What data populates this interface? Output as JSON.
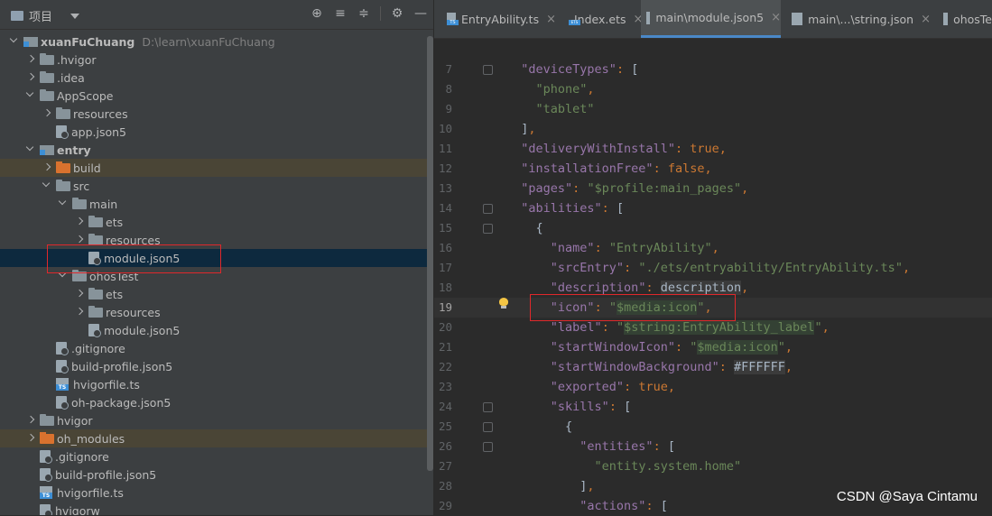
{
  "project_panel": {
    "title": "项目",
    "tools": [
      "crosshair-icon",
      "expand-all-icon",
      "collapse-all-icon",
      "gear-icon",
      "minimize-icon"
    ]
  },
  "tree": [
    {
      "label": "xuanFuChuang",
      "path": "D:\\learn\\xuanFuChuang",
      "depth": 0,
      "arrow": "down",
      "icon": "folder-blue",
      "bold": true
    },
    {
      "label": ".hvigor",
      "depth": 1,
      "arrow": "right",
      "icon": "folder"
    },
    {
      "label": ".idea",
      "depth": 1,
      "arrow": "right",
      "icon": "folder"
    },
    {
      "label": "AppScope",
      "depth": 1,
      "arrow": "down",
      "icon": "folder"
    },
    {
      "label": "resources",
      "depth": 2,
      "arrow": "right",
      "icon": "folder"
    },
    {
      "label": "app.json5",
      "depth": 2,
      "arrow": "none",
      "icon": "file"
    },
    {
      "label": "entry",
      "depth": 1,
      "arrow": "down",
      "icon": "folder-blue",
      "bold": true
    },
    {
      "label": "build",
      "depth": 2,
      "arrow": "right",
      "icon": "folder-orange",
      "highlight": true
    },
    {
      "label": "src",
      "depth": 2,
      "arrow": "down",
      "icon": "folder"
    },
    {
      "label": "main",
      "depth": 3,
      "arrow": "down",
      "icon": "folder"
    },
    {
      "label": "ets",
      "depth": 4,
      "arrow": "right",
      "icon": "folder"
    },
    {
      "label": "resources",
      "depth": 4,
      "arrow": "right",
      "icon": "folder"
    },
    {
      "label": "module.json5",
      "depth": 4,
      "arrow": "none",
      "icon": "file",
      "selected": true
    },
    {
      "label": "ohosTest",
      "depth": 3,
      "arrow": "down",
      "icon": "folder"
    },
    {
      "label": "ets",
      "depth": 4,
      "arrow": "right",
      "icon": "folder"
    },
    {
      "label": "resources",
      "depth": 4,
      "arrow": "right",
      "icon": "folder"
    },
    {
      "label": "module.json5",
      "depth": 4,
      "arrow": "none",
      "icon": "file"
    },
    {
      "label": ".gitignore",
      "depth": 2,
      "arrow": "none",
      "icon": "file"
    },
    {
      "label": "build-profile.json5",
      "depth": 2,
      "arrow": "none",
      "icon": "file"
    },
    {
      "label": "hvigorfile.ts",
      "depth": 2,
      "arrow": "none",
      "icon": "ts"
    },
    {
      "label": "oh-package.json5",
      "depth": 2,
      "arrow": "none",
      "icon": "file"
    },
    {
      "label": "hvigor",
      "depth": 1,
      "arrow": "right",
      "icon": "folder"
    },
    {
      "label": "oh_modules",
      "depth": 1,
      "arrow": "right",
      "icon": "folder-orange",
      "highlight": true
    },
    {
      "label": ".gitignore",
      "depth": 1,
      "arrow": "none",
      "icon": "file"
    },
    {
      "label": "build-profile.json5",
      "depth": 1,
      "arrow": "none",
      "icon": "file"
    },
    {
      "label": "hvigorfile.ts",
      "depth": 1,
      "arrow": "none",
      "icon": "ts"
    },
    {
      "label": "hvigorw",
      "depth": 1,
      "arrow": "none",
      "icon": "file"
    }
  ],
  "tabs": [
    {
      "label": "EntryAbility.ts",
      "icon": "ts"
    },
    {
      "label": "Index.ets",
      "icon": "ets"
    },
    {
      "label": "main\\module.json5",
      "icon": "file",
      "active": true
    },
    {
      "label": "main\\...\\string.json",
      "icon": "file"
    },
    {
      "label": "ohosTe",
      "icon": "file"
    }
  ],
  "code_lines": [
    {
      "n": "7",
      "html": "  <span class='k'>\"deviceTypes\"</span><span class='c'>:</span> ["
    },
    {
      "n": "8",
      "html": "    <span class='s'>\"phone\"</span><span class='c'>,</span>"
    },
    {
      "n": "9",
      "html": "    <span class='s'>\"tablet\"</span>"
    },
    {
      "n": "10",
      "html": "  ]<span class='c'>,</span>"
    },
    {
      "n": "11",
      "html": "  <span class='k'>\"deliveryWithInstall\"</span><span class='c'>:</span> <span class='c'>true,</span>"
    },
    {
      "n": "12",
      "html": "  <span class='k'>\"installationFree\"</span><span class='c'>:</span> <span class='c'>false,</span>"
    },
    {
      "n": "13",
      "html": "  <span class='k'>\"pages\"</span><span class='c'>:</span> <span class='s'>\"$profile:main_pages\"</span><span class='c'>,</span>"
    },
    {
      "n": "14",
      "html": "  <span class='k'>\"abilities\"</span><span class='c'>:</span> ["
    },
    {
      "n": "15",
      "html": "    {"
    },
    {
      "n": "16",
      "html": "      <span class='k'>\"name\"</span><span class='c'>:</span> <span class='s'>\"EntryAbility\"</span><span class='c'>,</span>"
    },
    {
      "n": "17",
      "html": "      <span class='k'>\"srcEntry\"</span><span class='c'>:</span> <span class='s'>\"./ets/entryability/EntryAbility.ts\"</span><span class='c'>,</span>"
    },
    {
      "n": "18",
      "html": "      <span class='k'>\"description\"</span><span class='c'>:</span> <span class='dim'>description</span><span class='c'>,</span>"
    },
    {
      "n": "19",
      "html": "      <span class='k'>\"icon\"</span><span class='c'>:</span> <span class='s'>\"<span class='icolbl'>$media:icon</span>\"</span><span class='c'>,</span>",
      "current": true
    },
    {
      "n": "20",
      "html": "      <span class='k'>\"label\"</span><span class='c'>:</span> <span class='s'>\"<span class='icolbl'>$string:EntryAbility_label</span>\"</span><span class='c'>,</span>"
    },
    {
      "n": "21",
      "html": "      <span class='k'>\"startWindowIcon\"</span><span class='c'>:</span> <span class='s'>\"<span class='icolbl'>$media:icon</span>\"</span><span class='c'>,</span>"
    },
    {
      "n": "22",
      "html": "      <span class='k'>\"startWindowBackground\"</span><span class='c'>:</span> <span class='dim'>#FFFFFF</span><span class='c'>,</span>"
    },
    {
      "n": "23",
      "html": "      <span class='k'>\"exported\"</span><span class='c'>:</span> <span class='c'>true,</span>"
    },
    {
      "n": "24",
      "html": "      <span class='k'>\"skills\"</span><span class='c'>:</span> ["
    },
    {
      "n": "25",
      "html": "        {"
    },
    {
      "n": "26",
      "html": "          <span class='k'>\"entities\"</span><span class='c'>:</span> ["
    },
    {
      "n": "27",
      "html": "            <span class='s'>\"entity.system.home\"</span>"
    },
    {
      "n": "28",
      "html": "          ]<span class='c'>,</span>"
    },
    {
      "n": "29",
      "html": "          <span class='k'>\"actions\"</span><span class='c'>:</span> ["
    }
  ],
  "watermark": "CSDN @Saya Cintamu",
  "colors": {
    "accent": "#4a88c7",
    "highlight_box": "#e0282b",
    "selection": "#0d293e"
  }
}
